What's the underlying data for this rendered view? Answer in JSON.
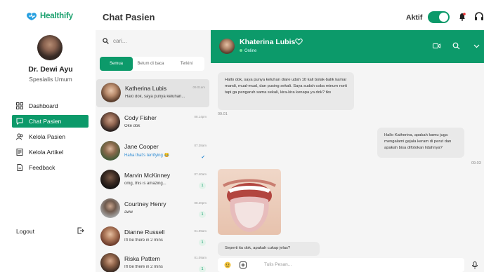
{
  "brand": {
    "name": "Healthify",
    "color": "#1aa06d"
  },
  "accent": "#0c9a6a",
  "profile": {
    "name": "Dr. Dewi Ayu",
    "role": "Spesialis Umum"
  },
  "nav": [
    {
      "label": "Dashboard",
      "icon": "dashboard-icon",
      "active": false
    },
    {
      "label": "Chat Pasien",
      "icon": "chat-icon",
      "active": true
    },
    {
      "label": "Kelola Pasien",
      "icon": "users-icon",
      "active": false
    },
    {
      "label": "Kelola Artikel",
      "icon": "article-icon",
      "active": false
    },
    {
      "label": "Feedback",
      "icon": "feedback-icon",
      "active": false
    }
  ],
  "logout": "Logout",
  "header": {
    "title": "Chat Pasien",
    "status_label": "Aktif",
    "status_on": true
  },
  "search": {
    "placeholder": "cari..."
  },
  "tabs": [
    "Semua",
    "Belum di baca",
    "Terkini"
  ],
  "contacts": [
    {
      "name": "Katherina Lubis",
      "message": "Halo dok, saya punya keluhan...",
      "time": "09.01am",
      "badge": "",
      "read": false,
      "selected": true
    },
    {
      "name": "Cody Fisher",
      "message": "Oke dok",
      "time": "08.14pm",
      "badge": "",
      "read": false,
      "selected": false
    },
    {
      "name": "Jane Cooper",
      "message": "Haha that's terrifying 😂",
      "time": "07.38am",
      "badge": "",
      "read": true,
      "selected": false
    },
    {
      "name": "Marvin McKinney",
      "message": "omg, this is amazing...",
      "time": "07.40am",
      "badge": "1",
      "read": false,
      "selected": false
    },
    {
      "name": "Courtney Henry",
      "message": "aww",
      "time": "08.20pm",
      "badge": "1",
      "read": false,
      "selected": false
    },
    {
      "name": "Dianne Russell",
      "message": "I'll be there in 2 mins",
      "time": "01.09am",
      "badge": "1",
      "read": false,
      "selected": false
    },
    {
      "name": "Riska Pattern",
      "message": "I'll be there in 2 mins",
      "time": "01.09am",
      "badge": "1",
      "read": false,
      "selected": false
    }
  ],
  "chat": {
    "name": "Khaterina Lubis",
    "status": "Online",
    "messages": [
      {
        "side": "left",
        "text": "Hallo dok, saya punya keluhan diare udah 10 kali bolak-balik kamar mandi, mual-mual, dan pusing sekali. Saya sudah coba minum norit tapi ga pengaruh sama sekali, kira-kira kenapa ya dok? tks",
        "time": "09.01"
      },
      {
        "side": "right",
        "text": "Hallo Katherina, apakah kamu juga mengalami gejala keram di perut dan apakah bisa difotokan lidahnya?",
        "time": "09.03"
      },
      {
        "side": "left",
        "text": "Seperti itu dok, apakah cukup jelas?",
        "time": ""
      }
    ],
    "input_placeholder": "Tulis Pesan..."
  }
}
